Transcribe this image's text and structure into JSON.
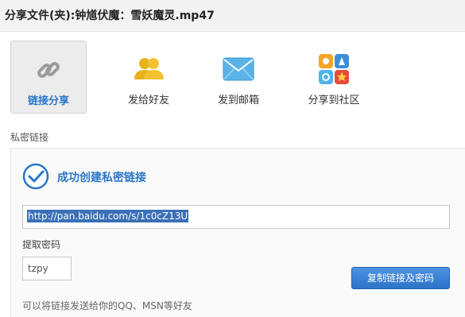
{
  "header": {
    "title": "分享文件(夹):钟馗伏魔：雪妖魔灵.mp47"
  },
  "tabs": [
    {
      "label": "链接分享",
      "icon": "link-icon",
      "active": true
    },
    {
      "label": "发给好友",
      "icon": "friends-icon",
      "active": false
    },
    {
      "label": "发到邮箱",
      "icon": "mail-icon",
      "active": false
    },
    {
      "label": "分享到社区",
      "icon": "community-icon",
      "active": false
    }
  ],
  "section": {
    "label": "私密链接"
  },
  "result": {
    "success_text": "成功创建私密链接",
    "link": "http://pan.baidu.com/s/1c0cZ13U",
    "password_label": "提取密码",
    "password": "tzpy",
    "copy_button": "复制链接及密码",
    "hint": "可以将链接发送给你的QQ、MSN等好友"
  },
  "colors": {
    "accent": "#2a75c8",
    "button": "#2d73c8",
    "selection": "#3b6fb6"
  }
}
